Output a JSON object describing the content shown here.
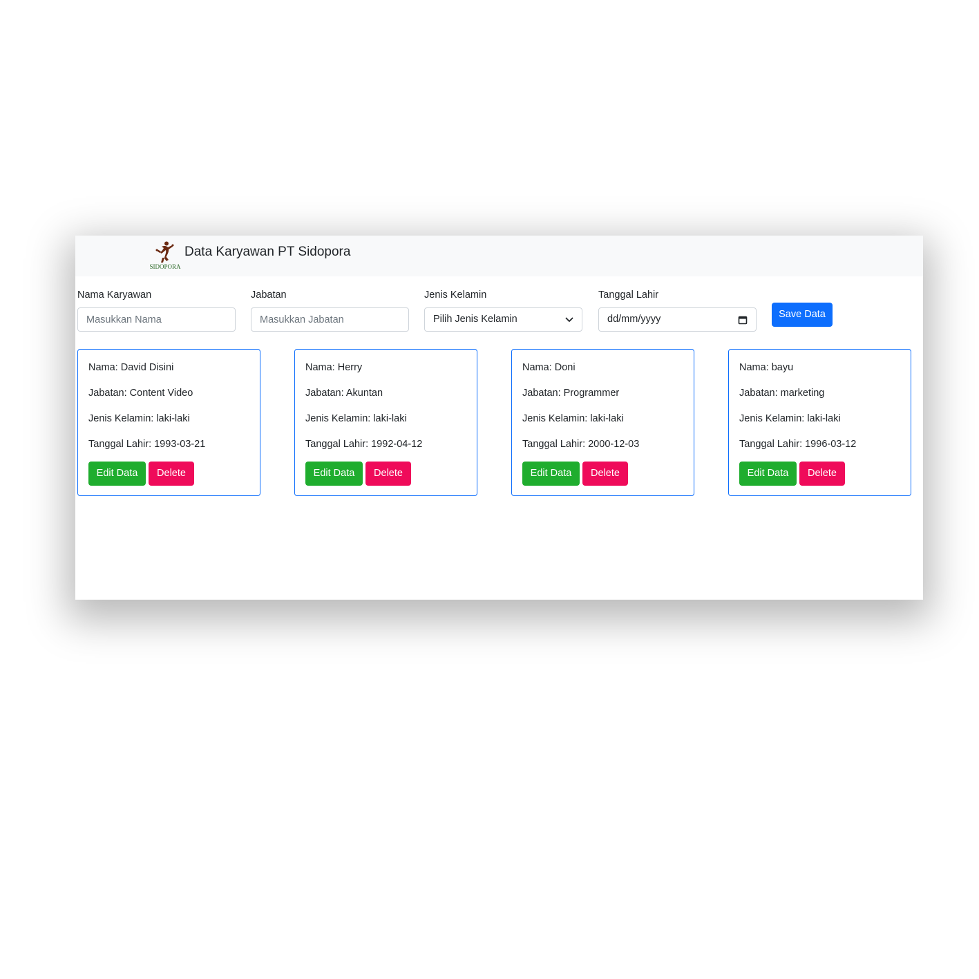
{
  "header": {
    "logo_text": "SIDOPORA",
    "title": "Data Karyawan PT Sidopora"
  },
  "form": {
    "nama": {
      "label": "Nama Karyawan",
      "placeholder": "Masukkan Nama",
      "value": ""
    },
    "jabatan": {
      "label": "Jabatan",
      "placeholder": "Masukkan Jabatan",
      "value": ""
    },
    "jenis_kelamin": {
      "label": "Jenis Kelamin",
      "selected": "Pilih Jenis Kelamin"
    },
    "tanggal_lahir": {
      "label": "Tanggal Lahir",
      "placeholder": "dd/mm/yyyy"
    },
    "save_label": "Save Data"
  },
  "employees": [
    {
      "nama": "Nama: David Disini",
      "jabatan": "Jabatan: Content Video",
      "jenis_kelamin": "Jenis Kelamin: laki-laki",
      "tanggal_lahir": "Tanggal Lahir: 1993-03-21"
    },
    {
      "nama": "Nama: Herry",
      "jabatan": "Jabatan: Akuntan",
      "jenis_kelamin": "Jenis Kelamin: laki-laki",
      "tanggal_lahir": "Tanggal Lahir: 1992-04-12"
    },
    {
      "nama": "Nama: Doni",
      "jabatan": "Jabatan: Programmer",
      "jenis_kelamin": "Jenis Kelamin: laki-laki",
      "tanggal_lahir": "Tanggal Lahir: 2000-12-03"
    },
    {
      "nama": "Nama: bayu",
      "jabatan": "Jabatan: marketing",
      "jenis_kelamin": "Jenis Kelamin: laki-laki",
      "tanggal_lahir": "Tanggal Lahir: 1996-03-12"
    }
  ],
  "card_actions": {
    "edit_label": "Edit Data",
    "delete_label": "Delete"
  },
  "colors": {
    "primary": "#0d6efd",
    "edit": "#1fad2e",
    "delete": "#ef0b5a",
    "navbar_bg": "#f8f9fa",
    "logo": "#6b2a12",
    "logo_text": "#2e6b2a"
  },
  "icons": {
    "logo": "runner-logo-icon",
    "select": "chevron-down-icon",
    "date": "calendar-icon"
  }
}
